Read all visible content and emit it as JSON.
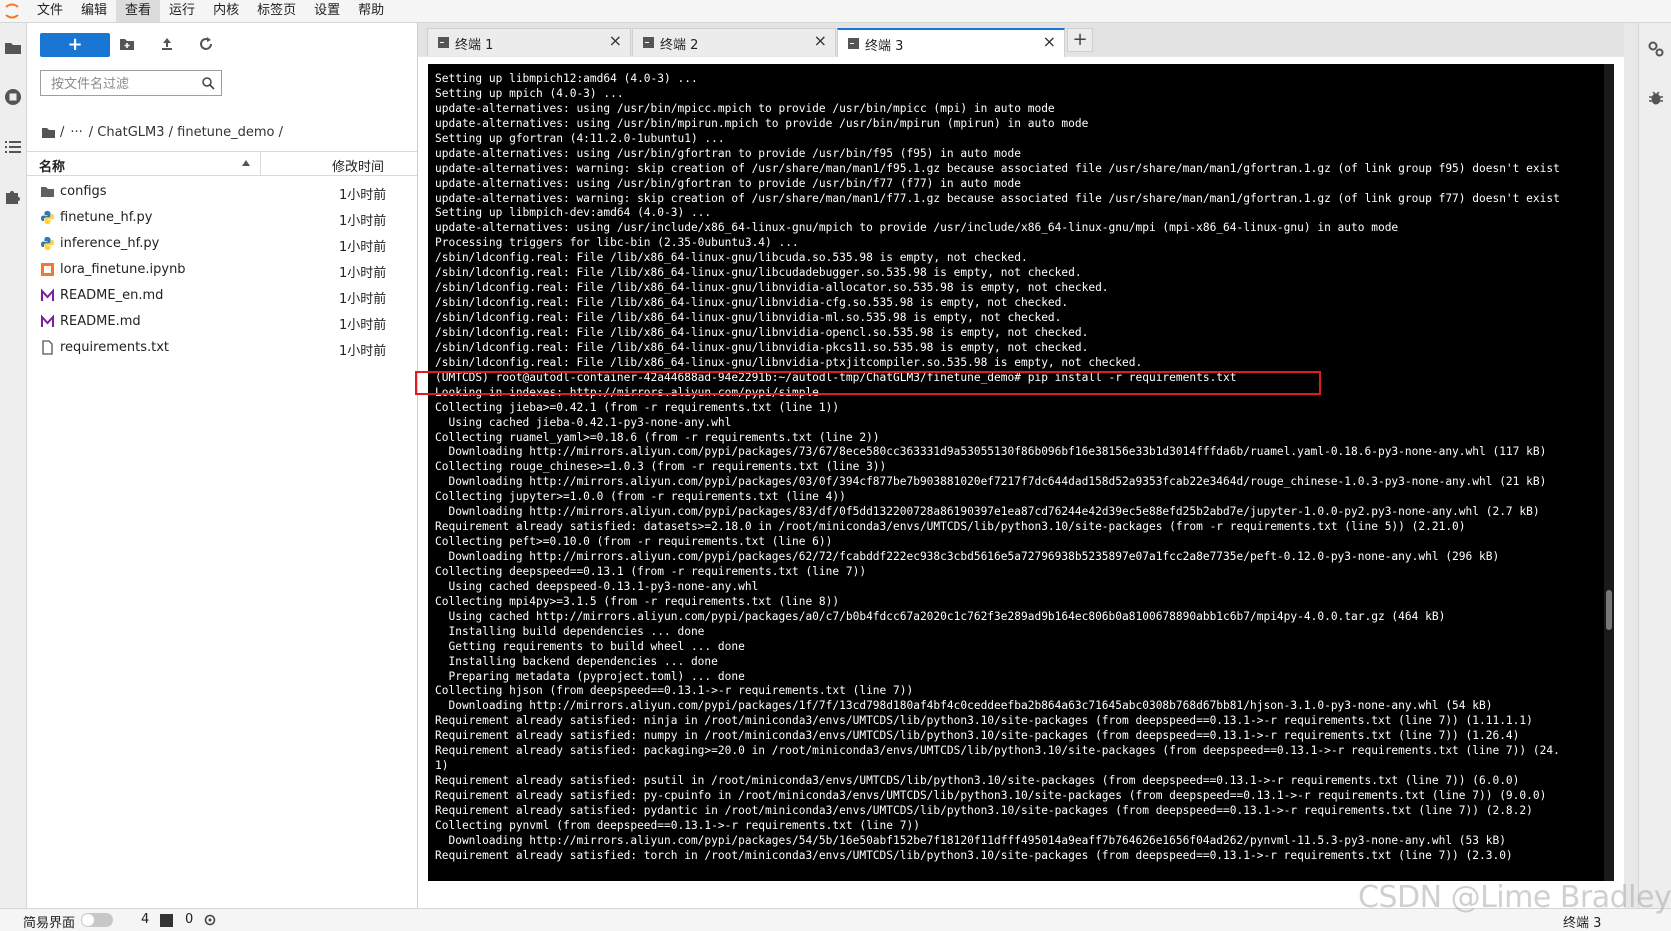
{
  "menubar": {
    "items": [
      "文件",
      "编辑",
      "查看",
      "运行",
      "内核",
      "标签页",
      "设置",
      "帮助"
    ],
    "active_item": "查看"
  },
  "filebrowser": {
    "new_button_label": "+",
    "filter_placeholder": "按文件名过滤",
    "breadcrumb": {
      "separator": "/",
      "ellipsis": "···",
      "path": "/ ChatGLM3 / finetune_demo /"
    },
    "columns": {
      "name": "名称",
      "modified": "修改时间"
    },
    "files": [
      {
        "name": "configs",
        "type": "folder",
        "modified": "1小时前"
      },
      {
        "name": "finetune_hf.py",
        "type": "python",
        "modified": "1小时前"
      },
      {
        "name": "inference_hf.py",
        "type": "python",
        "modified": "1小时前"
      },
      {
        "name": "lora_finetune.ipynb",
        "type": "notebook",
        "modified": "1小时前"
      },
      {
        "name": "README_en.md",
        "type": "markdown",
        "modified": "1小时前"
      },
      {
        "name": "README.md",
        "type": "markdown",
        "modified": "1小时前"
      },
      {
        "name": "requirements.txt",
        "type": "text",
        "modified": "1小时前"
      }
    ]
  },
  "tabs": [
    {
      "label": "终端 1",
      "active": false
    },
    {
      "label": "终端 2",
      "active": false
    },
    {
      "label": "终端 3",
      "active": true
    }
  ],
  "tab_add_label": "+",
  "terminal": {
    "lines": [
      "Setting up libmpich12:amd64 (4.0-3) ...",
      "Setting up mpich (4.0-3) ...",
      "update-alternatives: using /usr/bin/mpicc.mpich to provide /usr/bin/mpicc (mpi) in auto mode",
      "update-alternatives: using /usr/bin/mpirun.mpich to provide /usr/bin/mpirun (mpirun) in auto mode",
      "Setting up gfortran (4:11.2.0-1ubuntu1) ...",
      "update-alternatives: using /usr/bin/gfortran to provide /usr/bin/f95 (f95) in auto mode",
      "update-alternatives: warning: skip creation of /usr/share/man/man1/f95.1.gz because associated file /usr/share/man/man1/gfortran.1.gz (of link group f95) doesn't exist",
      "update-alternatives: using /usr/bin/gfortran to provide /usr/bin/f77 (f77) in auto mode",
      "update-alternatives: warning: skip creation of /usr/share/man/man1/f77.1.gz because associated file /usr/share/man/man1/gfortran.1.gz (of link group f77) doesn't exist",
      "Setting up libmpich-dev:amd64 (4.0-3) ...",
      "update-alternatives: using /usr/include/x86_64-linux-gnu/mpich to provide /usr/include/x86_64-linux-gnu/mpi (mpi-x86_64-linux-gnu) in auto mode",
      "Processing triggers for libc-bin (2.35-0ubuntu3.4) ...",
      "/sbin/ldconfig.real: File /lib/x86_64-linux-gnu/libcuda.so.535.98 is empty, not checked.",
      "/sbin/ldconfig.real: File /lib/x86_64-linux-gnu/libcudadebugger.so.535.98 is empty, not checked.",
      "/sbin/ldconfig.real: File /lib/x86_64-linux-gnu/libnvidia-allocator.so.535.98 is empty, not checked.",
      "/sbin/ldconfig.real: File /lib/x86_64-linux-gnu/libnvidia-cfg.so.535.98 is empty, not checked.",
      "/sbin/ldconfig.real: File /lib/x86_64-linux-gnu/libnvidia-ml.so.535.98 is empty, not checked.",
      "/sbin/ldconfig.real: File /lib/x86_64-linux-gnu/libnvidia-opencl.so.535.98 is empty, not checked.",
      "/sbin/ldconfig.real: File /lib/x86_64-linux-gnu/libnvidia-pkcs11.so.535.98 is empty, not checked.",
      "/sbin/ldconfig.real: File /lib/x86_64-linux-gnu/libnvidia-ptxjitcompiler.so.535.98 is empty, not checked.",
      "(UMTCDS) root@autodl-container-42a44688ad-94e2291b:~/autodl-tmp/ChatGLM3/finetune_demo# pip install -r requirements.txt",
      "Looking in indexes: http://mirrors.aliyun.com/pypi/simple",
      "Collecting jieba>=0.42.1 (from -r requirements.txt (line 1))",
      "  Using cached jieba-0.42.1-py3-none-any.whl",
      "Collecting ruamel_yaml>=0.18.6 (from -r requirements.txt (line 2))",
      "  Downloading http://mirrors.aliyun.com/pypi/packages/73/67/8ece580cc363331d9a53055130f86b096bf16e38156e33b1d3014fffda6b/ruamel.yaml-0.18.6-py3-none-any.whl (117 kB)",
      "Collecting rouge_chinese>=1.0.3 (from -r requirements.txt (line 3))",
      "  Downloading http://mirrors.aliyun.com/pypi/packages/03/0f/394cf877be7b903881020ef7217f7dc644dad158d52a9353fcab22e3464d/rouge_chinese-1.0.3-py3-none-any.whl (21 kB)",
      "Collecting jupyter>=1.0.0 (from -r requirements.txt (line 4))",
      "  Downloading http://mirrors.aliyun.com/pypi/packages/83/df/0f5dd132200728a86190397e1ea87cd76244e42d39ec5e88efd25b2abd7e/jupyter-1.0.0-py2.py3-none-any.whl (2.7 kB)",
      "Requirement already satisfied: datasets>=2.18.0 in /root/miniconda3/envs/UMTCDS/lib/python3.10/site-packages (from -r requirements.txt (line 5)) (2.21.0)",
      "Collecting peft>=0.10.0 (from -r requirements.txt (line 6))",
      "  Downloading http://mirrors.aliyun.com/pypi/packages/62/72/fcabddf222ec938c3cbd5616e5a72796938b5235897e07a1fcc2a8e7735e/peft-0.12.0-py3-none-any.whl (296 kB)",
      "Collecting deepspeed==0.13.1 (from -r requirements.txt (line 7))",
      "  Using cached deepspeed-0.13.1-py3-none-any.whl",
      "Collecting mpi4py>=3.1.5 (from -r requirements.txt (line 8))",
      "  Using cached http://mirrors.aliyun.com/pypi/packages/a0/c7/b0b4fdcc67a2020c1c762f3e289ad9b164ec806b0a8100678890abb1c6b7/mpi4py-4.0.0.tar.gz (464 kB)",
      "  Installing build dependencies ... done",
      "  Getting requirements to build wheel ... done",
      "  Installing backend dependencies ... done",
      "  Preparing metadata (pyproject.toml) ... done",
      "Collecting hjson (from deepspeed==0.13.1->-r requirements.txt (line 7))",
      "  Downloading http://mirrors.aliyun.com/pypi/packages/1f/7f/13cd798d180af4bf4c0ceddeefba2b864a63c71645abc0308b768d67bb81/hjson-3.1.0-py3-none-any.whl (54 kB)",
      "Requirement already satisfied: ninja in /root/miniconda3/envs/UMTCDS/lib/python3.10/site-packages (from deepspeed==0.13.1->-r requirements.txt (line 7)) (1.11.1.1)",
      "Requirement already satisfied: numpy in /root/miniconda3/envs/UMTCDS/lib/python3.10/site-packages (from deepspeed==0.13.1->-r requirements.txt (line 7)) (1.26.4)",
      "Requirement already satisfied: packaging>=20.0 in /root/miniconda3/envs/UMTCDS/lib/python3.10/site-packages (from deepspeed==0.13.1->-r requirements.txt (line 7)) (24.",
      "1)",
      "Requirement already satisfied: psutil in /root/miniconda3/envs/UMTCDS/lib/python3.10/site-packages (from deepspeed==0.13.1->-r requirements.txt (line 7)) (6.0.0)",
      "Requirement already satisfied: py-cpuinfo in /root/miniconda3/envs/UMTCDS/lib/python3.10/site-packages (from deepspeed==0.13.1->-r requirements.txt (line 7)) (9.0.0)",
      "Requirement already satisfied: pydantic in /root/miniconda3/envs/UMTCDS/lib/python3.10/site-packages (from deepspeed==0.13.1->-r requirements.txt (line 7)) (2.8.2)",
      "Collecting pynvml (from deepspeed==0.13.1->-r requirements.txt (line 7))",
      "  Downloading http://mirrors.aliyun.com/pypi/packages/54/5b/16e50abf152be7f18120f11dfff495014a9eaff7b764626e1656f04ad262/pynvml-11.5.3-py3-none-any.whl (53 kB)",
      "Requirement already satisfied: torch in /root/miniconda3/envs/UMTCDS/lib/python3.10/site-packages (from deepspeed==0.13.1->-r requirements.txt (line 7)) (2.3.0)"
    ]
  },
  "statusbar": {
    "simple_mode_label": "简易界面",
    "terminal_count": "4",
    "kernel_count": "0",
    "active_tab": "终端 3"
  },
  "watermark": "CSDN @Lime Bradley",
  "colors": {
    "accent": "#1976d2",
    "highlight": "#e01b1b",
    "terminal_bg": "#000000"
  }
}
